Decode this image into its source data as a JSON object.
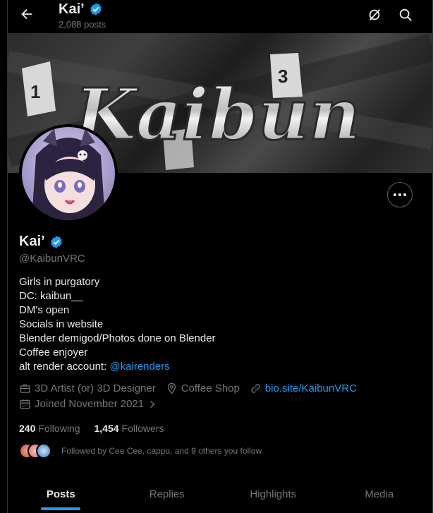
{
  "header": {
    "name": "Kai’",
    "posts_count": "2,088 posts"
  },
  "banner": {
    "text": "Kaibun",
    "markers": [
      "1",
      "3"
    ]
  },
  "profile": {
    "name": "Kai’",
    "handle": "@KaibunVRC",
    "bio_lines": [
      "Girls in purgatory",
      "DC: kaibun__",
      "DM's open",
      "Socials in website",
      "Blender demigod/Photos done on Blender",
      "Coffee enjoyer"
    ],
    "bio_last_prefix": "alt render account: ",
    "bio_last_mention": "@kairenders",
    "category": "3D Artist (or) 3D Designer",
    "location": "Coffee Shop",
    "website": "bio.site/KaibunVRC",
    "joined": "Joined November 2021",
    "following_count": "240",
    "following_label": "Following",
    "followers_count": "1,454",
    "followers_label": "Followers",
    "followed_by": "Followed by Cee Cee, cappu, and 9 others you follow"
  },
  "tabs": [
    {
      "label": "Posts",
      "active": true
    },
    {
      "label": "Replies",
      "active": false
    },
    {
      "label": "Highlights",
      "active": false
    },
    {
      "label": "Media",
      "active": false
    }
  ],
  "colors": {
    "accent": "#1d9bf0",
    "muted": "#71767b",
    "text": "#e7e9ea",
    "background": "#000000"
  }
}
